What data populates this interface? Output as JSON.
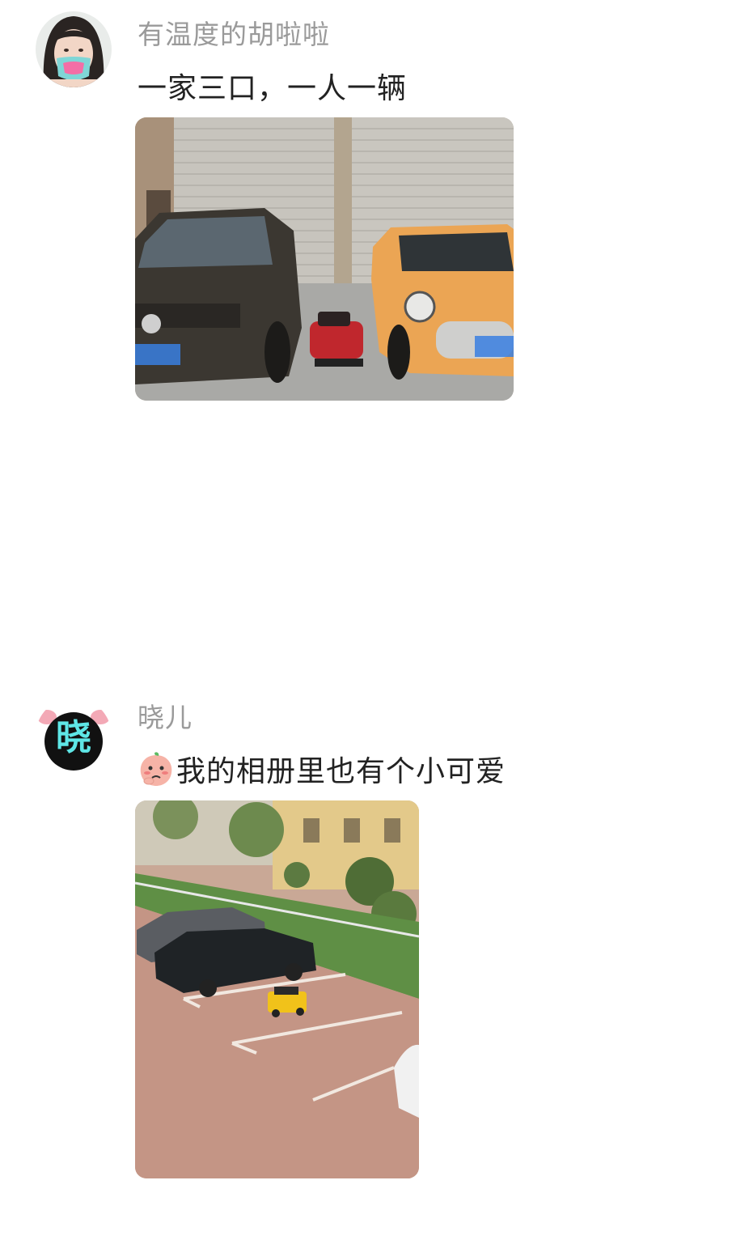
{
  "posts": [
    {
      "username": "有温度的胡啦啦",
      "caption": "一家三口，一人一辆",
      "avatar": "girl-with-pink-mask",
      "image": "three-cars-parked-photo"
    },
    {
      "username": "晓儿",
      "avatar_text": "晓",
      "caption_emoji": "shy-peach-emoji",
      "caption": "我的相册里也有个小可爱",
      "image": "parking-lot-toy-car-photo"
    }
  ],
  "colors": {
    "username": "#9a9a9a",
    "caption": "#222222",
    "background": "#ffffff",
    "avatar2_text": "#5ee6e6"
  }
}
